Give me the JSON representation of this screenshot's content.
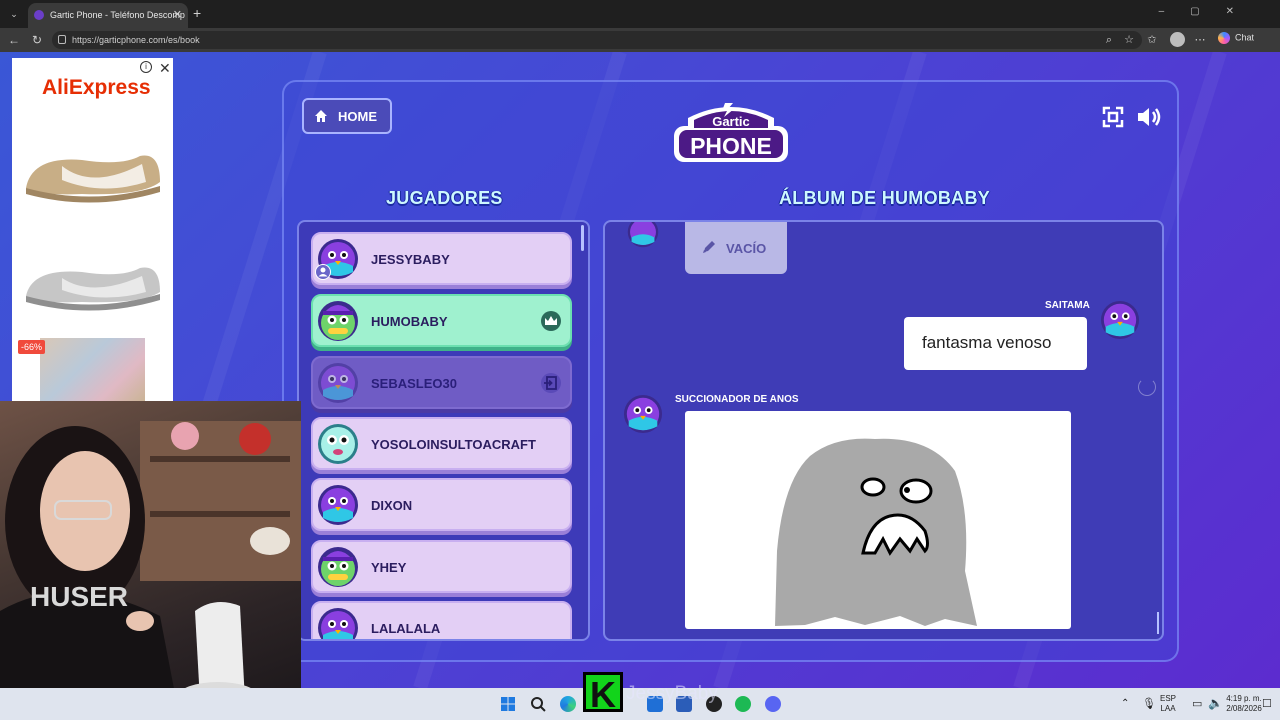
{
  "browser": {
    "tab_title": "Gartic Phone - Teléfono Descomp",
    "url": "https://garticphone.com/es/book",
    "chat_label": "Chat"
  },
  "ad": {
    "brand": "AliExpress",
    "discount": "-66%"
  },
  "game": {
    "home_label": "HOME",
    "logo_top": "Gartic",
    "logo_bottom": "PHONE",
    "players_title": "JUGADORES",
    "album_title": "ÁLBUM DE HUMOBABY",
    "players": [
      {
        "name": "JESSYBABY",
        "state": "normal",
        "badge": "user-icon",
        "avatar": "purple-bird"
      },
      {
        "name": "HUMOBABY",
        "state": "active",
        "badge": "crown-icon",
        "avatar": "green-frog-hat"
      },
      {
        "name": "SEBASLEO30",
        "state": "dim",
        "badge": "exit-icon",
        "avatar": "purple-bird"
      },
      {
        "name": "YOSOLOINSULTOACRAFT",
        "state": "normal",
        "badge": "",
        "avatar": "cyan-ghost"
      },
      {
        "name": "DIXON",
        "state": "normal",
        "badge": "",
        "avatar": "purple-bird"
      },
      {
        "name": "YHEY",
        "state": "normal",
        "badge": "",
        "avatar": "green-frog-hat"
      },
      {
        "name": "LALALALA",
        "state": "normal",
        "badge": "",
        "avatar": "purple-bird"
      }
    ],
    "album": {
      "vacio_label": "VACÍO",
      "saitama_label": "SAITAMA",
      "saitama_text": "fantasma venoso",
      "drawer_label": "SUCCIONADOR DE ANOS"
    }
  },
  "overlay": {
    "k_letter": "K",
    "streamer_name": "JessyBaby"
  },
  "taskbar": {
    "lang_top": "ESP",
    "lang_bottom": "LAA",
    "time": "4:19 p. m.",
    "date": "2/08/2026"
  }
}
